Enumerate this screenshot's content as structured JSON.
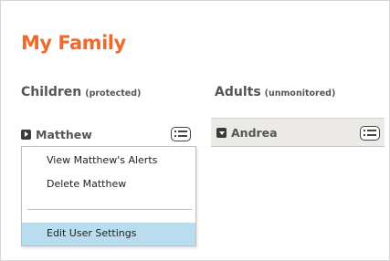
{
  "page": {
    "title": "My Family"
  },
  "children_section": {
    "heading": "Children",
    "subheading": "(protected)",
    "users": [
      {
        "name": "Matthew",
        "icon": "triangle-right-icon",
        "menu_icon": "list-menu-icon"
      }
    ]
  },
  "adults_section": {
    "heading": "Adults",
    "subheading": "(unmonitored)",
    "users": [
      {
        "name": "Andrea",
        "icon": "triangle-down-icon",
        "menu_icon": "list-menu-icon"
      }
    ]
  },
  "context_menu": {
    "items": [
      {
        "label": "View Matthew's Alerts"
      },
      {
        "label": "Delete Matthew"
      },
      {
        "label": "Edit User Settings",
        "highlighted": true
      }
    ]
  },
  "colors": {
    "title": "#ee6a2d",
    "highlight": "#b9dcee",
    "row_selected_bg": "#eceae6"
  }
}
